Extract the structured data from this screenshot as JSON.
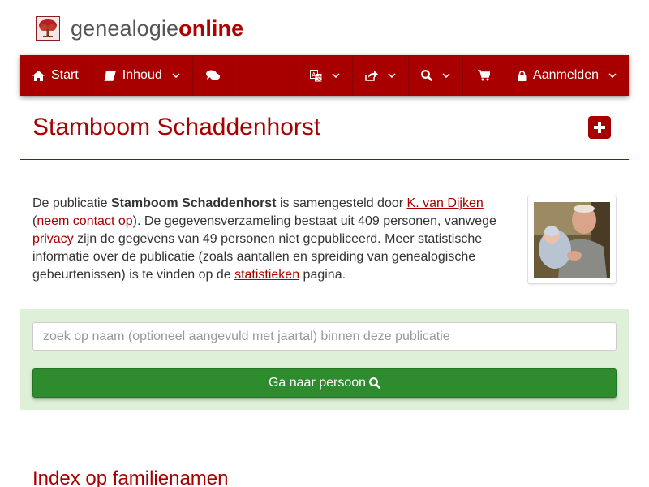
{
  "brand": {
    "part1": "genealogie",
    "part2": "online"
  },
  "nav": {
    "start": "Start",
    "inhoud": "Inhoud",
    "aanmelden": "Aanmelden"
  },
  "icons": {
    "logo": "tree-icon",
    "start": "home-icon",
    "inhoud": "book-icon",
    "chat": "comments-icon",
    "language": "translate-icon",
    "share": "share-icon",
    "search": "search-icon",
    "cart": "shopping-cart-icon",
    "login": "lock-icon",
    "plus": "plus-square-icon"
  },
  "colors": {
    "brand": "#a80000",
    "panel": "#dff0d8",
    "button": "#2e8b2e"
  },
  "page": {
    "title": "Stamboom Schaddenhorst"
  },
  "intro": {
    "t1": "De publicatie ",
    "pub_name": "Stamboom Schaddenhorst",
    "t2": " is samengesteld door ",
    "author": "K. van Dijken",
    "t3": "(",
    "contact": "neem contact op",
    "t4": "). De gegevensverzameling bestaat uit 409 personen, vanwege ",
    "privacy": "privacy",
    "t5": " zijn de gegevens van 49 personen niet gepubliceerd. Meer statistische informatie over de publicatie (zoals aantallen en spreiding van genealogische gebeurtenissen) is te vinden op de ",
    "stats": "statistieken",
    "t6": " pagina."
  },
  "search": {
    "placeholder": "zoek op naam (optioneel aangevuld met jaartal) binnen deze publicatie",
    "button": "Ga naar persoon"
  },
  "section": {
    "heading": "Index op familienamen"
  }
}
